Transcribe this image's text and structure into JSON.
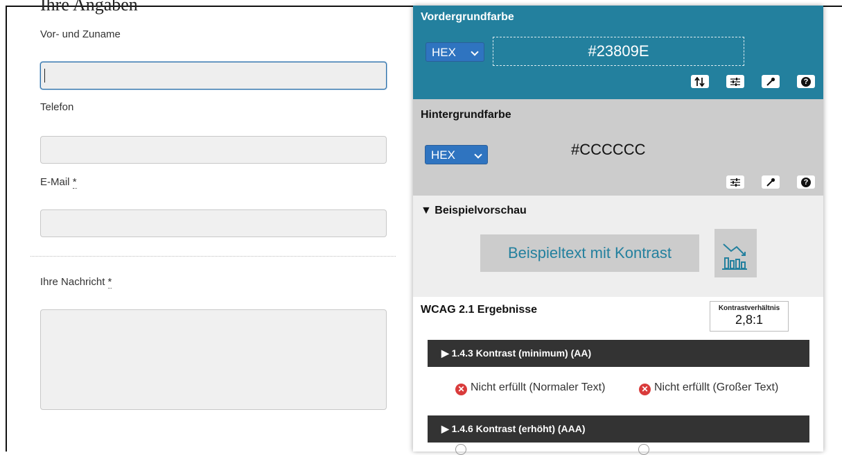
{
  "form": {
    "heading": "Ihre Angaben",
    "name_label": "Vor- und Zuname",
    "phone_label": "Telefon",
    "email_label": "E-Mail",
    "message_label": "Ihre Nachricht",
    "required_mark": "*"
  },
  "foreground": {
    "title": "Vordergrundfarbe",
    "format": "HEX",
    "value": "#23809E",
    "color": "#23809e"
  },
  "background": {
    "title": "Hintergrundfarbe",
    "format": "HEX",
    "value": "#CCCCCC",
    "color": "#cccccc"
  },
  "preview": {
    "title": "▼ Beispielvorschau",
    "sample_text": "Beispieltext mit Kontrast"
  },
  "results": {
    "title": "WCAG 2.1 Ergebnisse",
    "ratio_label": "Kontrastverhältnis",
    "ratio_value": "2,8:1",
    "sections": [
      {
        "title": "▶ 1.4.3 Kontrast (minimum) (AA)",
        "normal": "Nicht erfüllt (Normaler Text)",
        "large": "Nicht erfüllt (Großer Text)"
      },
      {
        "title": "▶ 1.4.6 Kontrast (erhöht) (AAA)"
      }
    ]
  },
  "icons": [
    "swap-icon",
    "sliders-icon",
    "eyedropper-icon",
    "help-icon",
    "chart-icon",
    "fail-icon"
  ]
}
